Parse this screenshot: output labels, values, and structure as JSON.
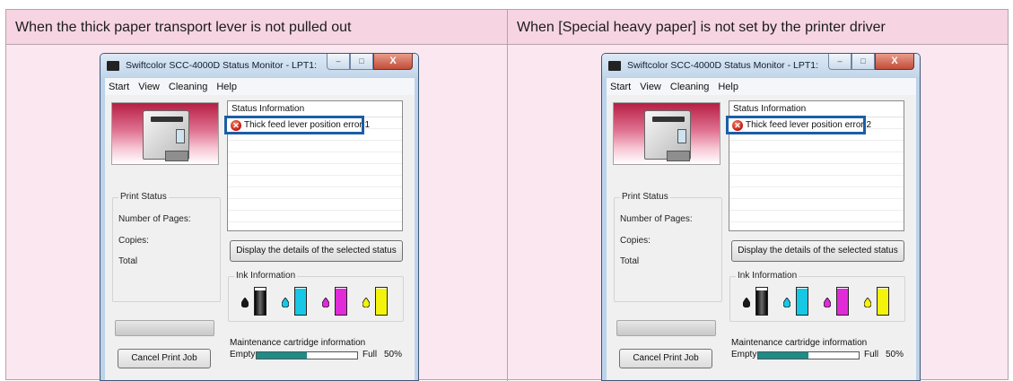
{
  "table": {
    "headers": [
      "When the thick paper transport lever is not pulled out",
      "When [Special heavy paper] is not set by the printer driver"
    ]
  },
  "window": {
    "title": "Swiftcolor SCC-4000D Status Monitor - LPT1:",
    "controls": {
      "minimize": "–",
      "maximize": "□",
      "close": "X"
    }
  },
  "menu": [
    "Start",
    "View",
    "Cleaning",
    "Help"
  ],
  "print_status": {
    "legend": "Print Status",
    "number_of_pages": "Number of Pages:",
    "copies": "Copies:",
    "total": "Total"
  },
  "status_info": {
    "header": "Status Information",
    "errors": [
      "Thick feed lever position error 1",
      "Thick feed lever position error 2"
    ],
    "icon": "error-circle-icon"
  },
  "buttons": {
    "details": "Display the details of the selected status",
    "cancel": "Cancel Print Job"
  },
  "ink": {
    "legend": "Ink Information",
    "cartridges": [
      {
        "name": "black",
        "color": "#1a1a1a",
        "level": 0.9
      },
      {
        "name": "cyan",
        "color": "#16c8e6",
        "level": 0.96
      },
      {
        "name": "magenta",
        "color": "#e12bd8",
        "level": 0.96
      },
      {
        "name": "yellow",
        "color": "#f3f30c",
        "level": 0.96
      }
    ]
  },
  "maintenance": {
    "label": "Maintenance cartridge information",
    "empty": "Empty",
    "full": "Full",
    "percent": "50%",
    "level": 0.5
  },
  "colors": {
    "highlight": "#1b5ea6",
    "maintenance_fill": "#1e8c87"
  }
}
